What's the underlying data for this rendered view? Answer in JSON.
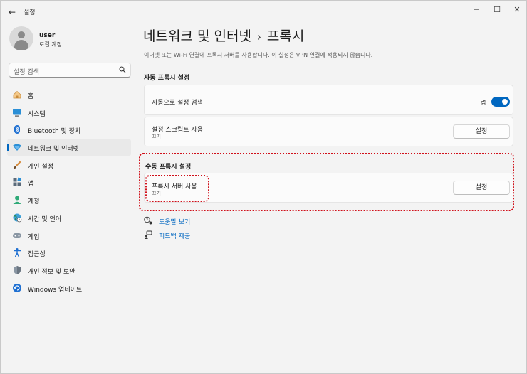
{
  "window": {
    "title": "설정",
    "back_glyph": "←",
    "minimize_glyph": "─",
    "maximize_glyph": "☐",
    "close_glyph": "✕"
  },
  "user": {
    "name": "user",
    "account": "로컬 계정"
  },
  "search": {
    "placeholder": "설정 검색"
  },
  "sidebar": {
    "items": [
      {
        "label": "홈",
        "icon": "home-icon",
        "active": false
      },
      {
        "label": "시스템",
        "icon": "system-icon",
        "active": false
      },
      {
        "label": "Bluetooth 및 장치",
        "icon": "bluetooth-icon",
        "active": false
      },
      {
        "label": "네트워크 및 인터넷",
        "icon": "network-icon",
        "active": true
      },
      {
        "label": "개인 설정",
        "icon": "brush-icon",
        "active": false
      },
      {
        "label": "앱",
        "icon": "apps-icon",
        "active": false
      },
      {
        "label": "계정",
        "icon": "account-icon",
        "active": false
      },
      {
        "label": "시간 및 언어",
        "icon": "globe-icon",
        "active": false
      },
      {
        "label": "게임",
        "icon": "gamepad-icon",
        "active": false
      },
      {
        "label": "접근성",
        "icon": "accessibility-icon",
        "active": false
      },
      {
        "label": "개인 정보 및 보안",
        "icon": "shield-icon",
        "active": false
      },
      {
        "label": "Windows 업데이트",
        "icon": "update-icon",
        "active": false
      }
    ]
  },
  "breadcrumb": {
    "parent": "네트워크 및 인터넷",
    "separator": "›",
    "current": "프록시"
  },
  "description": "이더넷 또는 Wi-Fi 연결에 프록시 서버를 사용합니다. 이 설정은 VPN 연결에 적용되지 않습니다.",
  "auto_proxy": {
    "section_title": "자동 프록시 설정",
    "detect": {
      "label": "자동으로 설정 검색",
      "toggle_label": "켬",
      "toggle_on": true
    },
    "script": {
      "label": "설정 스크립트 사용",
      "status": "끄기",
      "button": "설정"
    }
  },
  "manual_proxy": {
    "section_title": "수동 프록시 설정",
    "server": {
      "label": "프록시 서버 사용",
      "status": "끄기",
      "button": "설정"
    }
  },
  "links": {
    "help": "도움말 보기",
    "feedback": "피드백 제공"
  },
  "colors": {
    "accent": "#0067c0",
    "highlight": "#d0101a"
  }
}
